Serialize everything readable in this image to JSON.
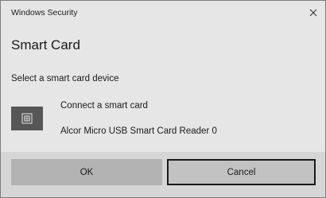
{
  "window": {
    "title": "Windows Security",
    "close_icon": "close-icon"
  },
  "dialog": {
    "heading": "Smart Card",
    "prompt": "Select a smart card device"
  },
  "device": {
    "title": "Connect a smart card",
    "subtitle": "Alcor Micro USB Smart Card Reader 0",
    "icon": "smart-card-icon"
  },
  "buttons": {
    "ok_label": "OK",
    "cancel_label": "Cancel"
  }
}
